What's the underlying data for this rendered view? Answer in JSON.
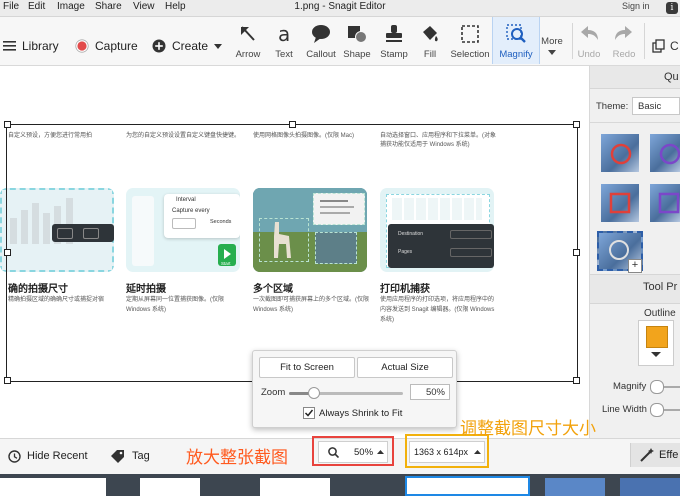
{
  "menubar": {
    "items": [
      "File",
      "Edit",
      "Image",
      "Share",
      "View",
      "Help"
    ],
    "title": "1.png - Snagit Editor",
    "signin": "Sign in"
  },
  "toolbar": {
    "library": "Library",
    "capture": "Capture",
    "create": "Create",
    "tools": [
      "Arrow",
      "Text",
      "Callout",
      "Shape",
      "Stamp",
      "Fill",
      "Selection",
      "Magnify"
    ],
    "more": "More",
    "undo": "Undo",
    "redo": "Redo",
    "capture_color": "#e24b4b",
    "accent": "#1f5fbf"
  },
  "canvas": {
    "top_text": [
      "自定义预设，方便您进行常用拍",
      "为您的自定义预设设置自定义键盘快捷键。",
      "使用网格图像头拍摄图像。(仅限 Mac)",
      "自动选择窗口、应用程序和下拉菜单。(对象捕获功能仅适用于 Windows 系统)"
    ],
    "cards": [
      {
        "title": "确的拍摄尺寸",
        "desc": "精确拍摄区域的确确尺寸或捕捉对宿"
      },
      {
        "title": "延时拍摄",
        "desc": "定期从屏幕同一位置捕获图像。(仅限 Windows 系统)"
      },
      {
        "title": "多个区域",
        "desc": "一次截图即可捕获屏幕上的多个区域。(仅限 Windows 系统)"
      },
      {
        "title": "打印机捕获",
        "desc": "使用应用程序的打印选项，将应用程序中的内容发送到 Snagit 编辑器。(仅限 Windows 系统)"
      }
    ],
    "card_labels": {
      "interval": "Interval",
      "capture_every": "Capture every",
      "seconds": "Seconds",
      "start": "Start",
      "destination": "Destination",
      "pages": "Pages"
    }
  },
  "popup": {
    "fit_to_screen": "Fit to Screen",
    "actual_size": "Actual Size",
    "zoom_label": "Zoom",
    "zoom_value": "50%",
    "always_shrink": "Always Shrink to Fit",
    "always_shrink_checked": true,
    "zoom_fraction": 0.22
  },
  "rpanel": {
    "header": "Qu",
    "theme_label": "Theme:",
    "theme_value": "Basic",
    "tool_props": "Tool Pr",
    "outline": "Outline",
    "outline_color": "#f2a41c",
    "magnify": "Magnify",
    "line_width": "Line Width"
  },
  "bottombar": {
    "hide_recent": "Hide Recent",
    "tag": "Tag",
    "zoom_value": "50%",
    "size_value": "1363 x 614px",
    "effects": "Effe"
  },
  "annotations": {
    "zoom_note": "放大整张截图",
    "resize_note": "调整截图尺寸大小"
  }
}
